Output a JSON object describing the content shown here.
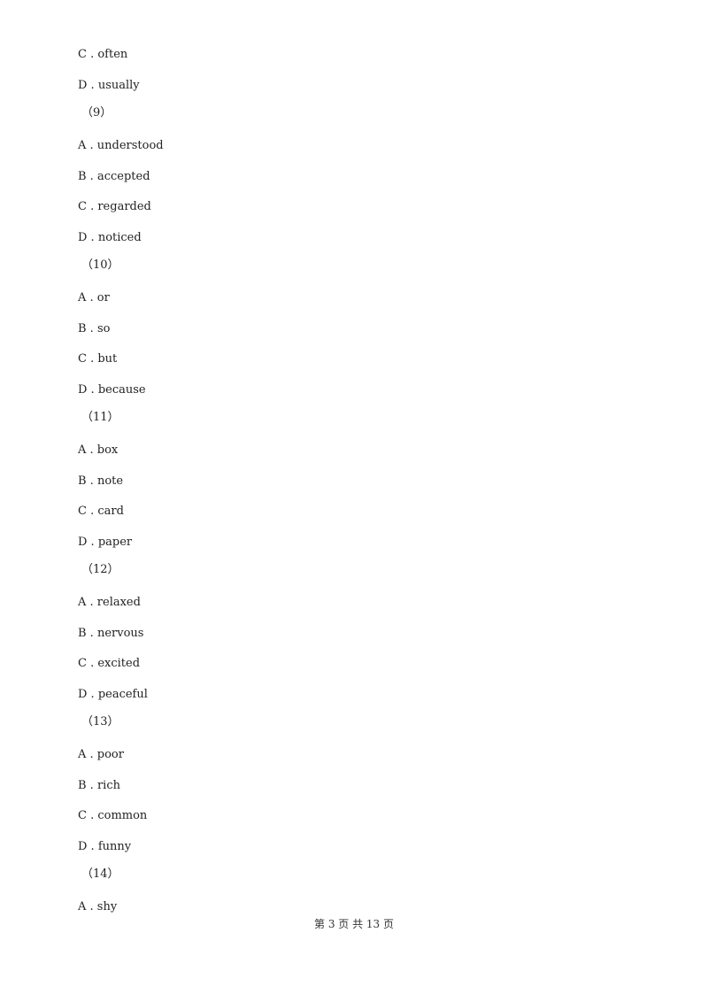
{
  "lines": [
    {
      "type": "option",
      "text": "C . often"
    },
    {
      "type": "option",
      "text": "D . usually"
    },
    {
      "type": "question",
      "text": "（9）"
    },
    {
      "type": "option",
      "text": "A . understood"
    },
    {
      "type": "option",
      "text": "B . accepted"
    },
    {
      "type": "option",
      "text": "C . regarded"
    },
    {
      "type": "option",
      "text": "D . noticed"
    },
    {
      "type": "question",
      "text": "（10）"
    },
    {
      "type": "option",
      "text": "A . or"
    },
    {
      "type": "option",
      "text": "B . so"
    },
    {
      "type": "option",
      "text": "C . but"
    },
    {
      "type": "option",
      "text": "D . because"
    },
    {
      "type": "question",
      "text": "（11）"
    },
    {
      "type": "option",
      "text": "A . box"
    },
    {
      "type": "option",
      "text": "B . note"
    },
    {
      "type": "option",
      "text": "C . card"
    },
    {
      "type": "option",
      "text": "D . paper"
    },
    {
      "type": "question",
      "text": "（12）"
    },
    {
      "type": "option",
      "text": "A . relaxed"
    },
    {
      "type": "option",
      "text": "B . nervous"
    },
    {
      "type": "option",
      "text": "C . excited"
    },
    {
      "type": "option",
      "text": "D . peaceful"
    },
    {
      "type": "question",
      "text": "（13）"
    },
    {
      "type": "option",
      "text": "A . poor"
    },
    {
      "type": "option",
      "text": "B . rich"
    },
    {
      "type": "option",
      "text": "C . common"
    },
    {
      "type": "option",
      "text": "D . funny"
    },
    {
      "type": "question",
      "text": "（14）"
    },
    {
      "type": "option",
      "text": "A . shy"
    }
  ],
  "footer": "第 3 页 共 13 页"
}
